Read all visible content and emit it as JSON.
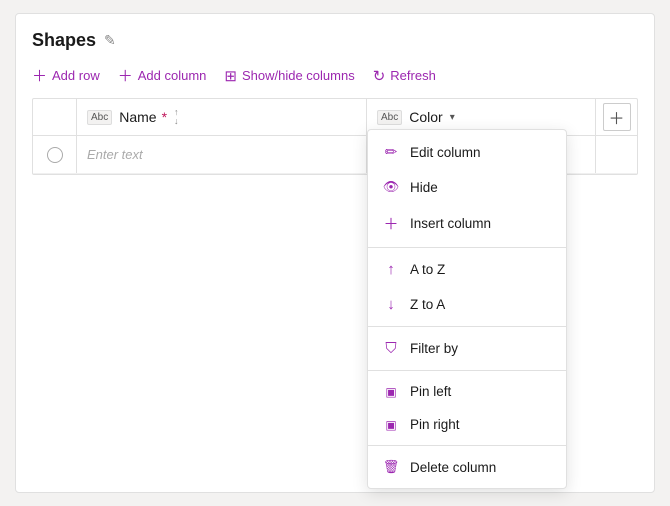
{
  "panel": {
    "title": "Shapes",
    "edit_tooltip": "Edit"
  },
  "toolbar": {
    "add_row": "Add row",
    "add_column": "Add column",
    "show_hide": "Show/hide columns",
    "refresh": "Refresh"
  },
  "grid": {
    "columns": [
      {
        "id": "name",
        "label": "Name",
        "required": true,
        "tag": "Abc"
      },
      {
        "id": "color",
        "label": "Color",
        "required": false,
        "tag": "Abc"
      }
    ],
    "add_btn_label": "+",
    "placeholder_text": "Enter text"
  },
  "dropdown": {
    "items": [
      {
        "id": "edit-column",
        "label": "Edit column",
        "icon": "pencil"
      },
      {
        "id": "hide",
        "label": "Hide",
        "icon": "eye-off"
      },
      {
        "id": "insert-column",
        "label": "Insert column",
        "icon": "plus"
      },
      {
        "id": "a-to-z",
        "label": "A to Z",
        "icon": "arrow-up"
      },
      {
        "id": "z-to-a",
        "label": "Z to A",
        "icon": "arrow-down"
      },
      {
        "id": "filter-by",
        "label": "Filter by",
        "icon": "filter"
      },
      {
        "id": "pin-left",
        "label": "Pin left",
        "icon": "pin-left"
      },
      {
        "id": "pin-right",
        "label": "Pin right",
        "icon": "pin-right"
      },
      {
        "id": "delete-column",
        "label": "Delete column",
        "icon": "trash"
      }
    ]
  }
}
